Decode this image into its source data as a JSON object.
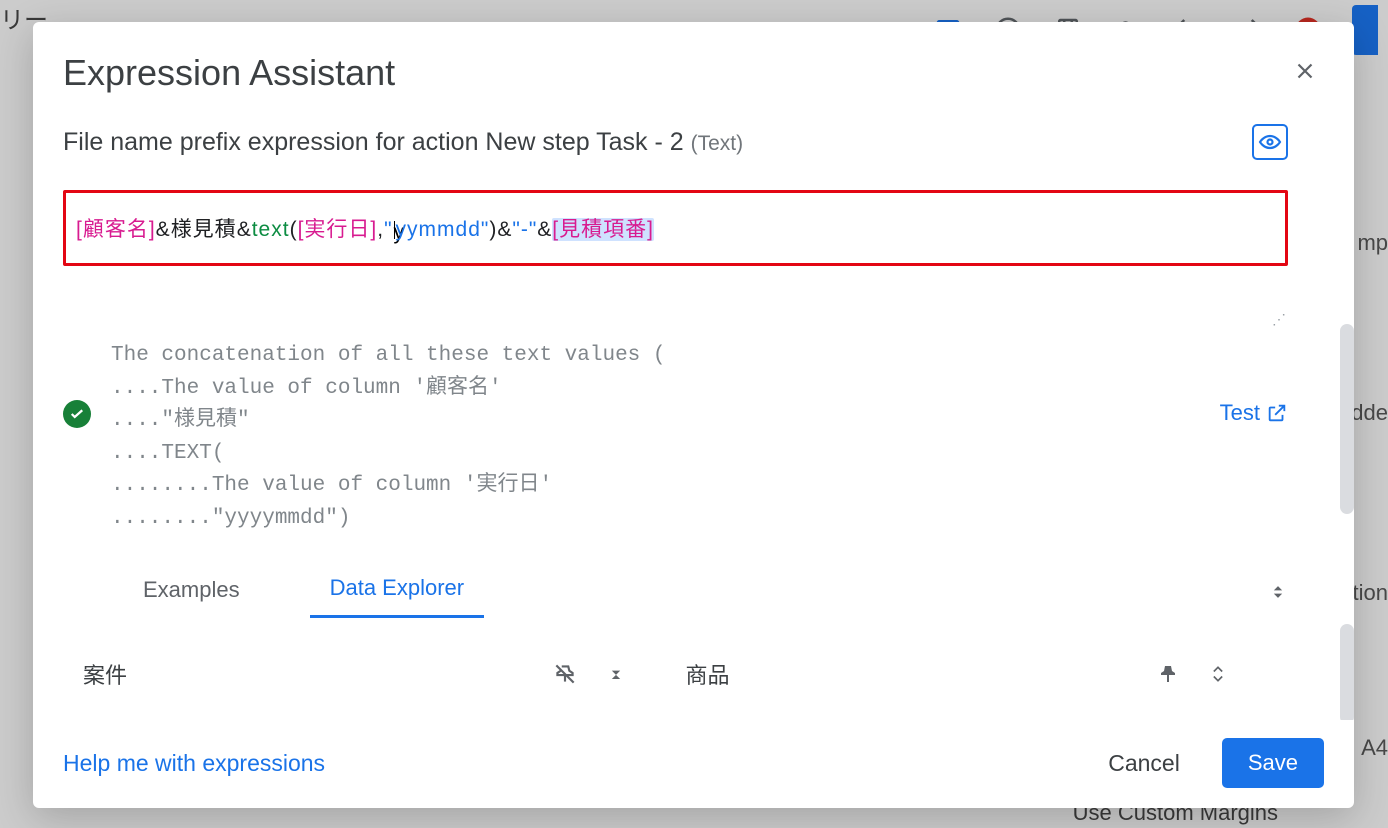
{
  "background": {
    "topleft": "リー",
    "right1": "mp ",
    "right2": "adde",
    "right3": "tion",
    "right4": "A4",
    "bottom": "Use Custom Margins"
  },
  "modal": {
    "title": "Expression Assistant",
    "expr_label_pre": "File name prefix expression for action New step Task - 2 ",
    "expr_label_type": "(Text)",
    "editor": {
      "col1": "[顧客名]",
      "amp1": "&",
      "jp1": "様見積",
      "amp2": "&",
      "fn": "text",
      "paren_open": "(",
      "col2": "[実行日]",
      "comma": ",",
      "str1_pre": "\"",
      "str1_post": "yymmdd\"",
      "paren_close": ")",
      "amp3": "&",
      "str2": "\"-\"",
      "amp4": "&",
      "col3": "[見積項番]"
    },
    "explanation": "The concatenation of all these text values (\n....The value of column '顧客名'\n....\"様見積\"\n....TEXT(\n........The value of column '実行日'\n........\"yyyymmdd\")",
    "test_label": "Test",
    "tabs": {
      "examples": "Examples",
      "data_explorer": "Data Explorer"
    },
    "tables": {
      "t1": "案件",
      "t2": "商品"
    },
    "footer": {
      "help": "Help me with expressions",
      "cancel": "Cancel",
      "save": "Save"
    }
  }
}
